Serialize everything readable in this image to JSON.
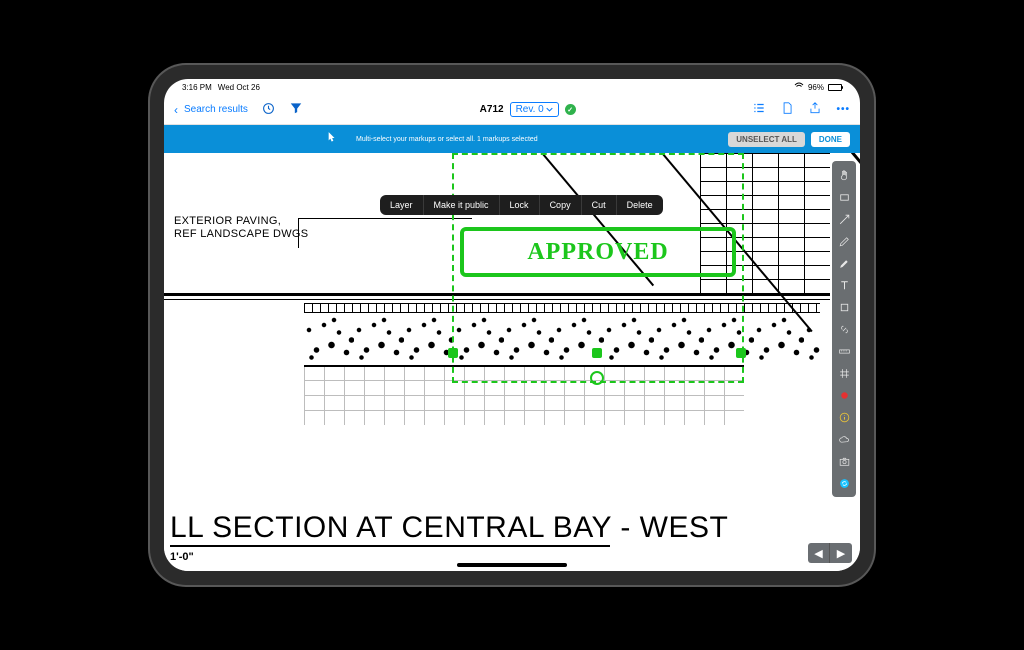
{
  "status": {
    "time": "3:16 PM",
    "date": "Wed Oct 26",
    "battery": "96%"
  },
  "nav": {
    "back": "Search results",
    "doc_id": "A712",
    "revision": "Rev. 0",
    "icons": {
      "clock": "recent-icon",
      "filter": "filter-icon",
      "list": "list-icon",
      "doc": "document-icon",
      "share": "share-icon",
      "more": "more-icon"
    }
  },
  "action_bar": {
    "message": "Multi-select your markups or select all. 1 markups selected",
    "unselect": "UNSELECT ALL",
    "done": "DONE"
  },
  "context_menu": [
    "Layer",
    "Make it public",
    "Lock",
    "Copy",
    "Cut",
    "Delete"
  ],
  "drawing": {
    "note": "EXTERIOR PAVING,\nREF LANDSCAPE DWGS",
    "stamp": "APPROVED",
    "title": "LL SECTION AT CENTRAL BAY - WEST",
    "scale": "1'-0\""
  },
  "toolbar": [
    "hand",
    "rect",
    "arrow",
    "pen",
    "highlighter",
    "text",
    "shape",
    "link",
    "ruler",
    "hash",
    "record",
    "info",
    "cloud",
    "camera",
    "sync"
  ]
}
